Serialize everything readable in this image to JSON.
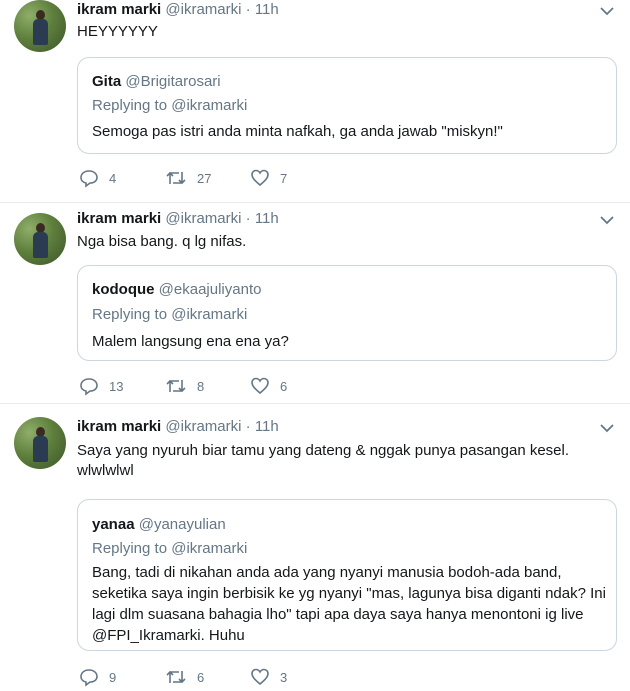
{
  "tweets": [
    {
      "name": "ikram marki",
      "handle": "@ikramarki",
      "dot": "·",
      "time": "11h",
      "text": "HEYYYYYY",
      "quote": {
        "name": "Gita",
        "handle": "@Brigitarosari",
        "replying": "Replying to @ikramarki",
        "text": "Semoga pas istri anda minta nafkah, ga anda jawab \"miskyn!\""
      },
      "replies": "4",
      "retweets": "27",
      "likes": "7"
    },
    {
      "name": "ikram marki",
      "handle": "@ikramarki",
      "dot": "·",
      "time": "11h",
      "text": "Nga bisa bang. q lg nifas.",
      "quote": {
        "name": "kodoque",
        "handle": "@ekaajuliyanto",
        "replying": "Replying to @ikramarki",
        "text": "Malem langsung ena ena ya?"
      },
      "replies": "13",
      "retweets": "8",
      "likes": "6"
    },
    {
      "name": "ikram marki",
      "handle": "@ikramarki",
      "dot": "·",
      "time": "11h",
      "text": "Saya yang nyuruh biar tamu yang dateng & nggak punya pasangan kesel. wlwlwlwl",
      "quote": {
        "name": "yanaa",
        "handle": "@yanayulian",
        "replying": "Replying to @ikramarki",
        "text": "Bang, tadi di nikahan anda ada yang nyanyi manusia bodoh-ada band, seketika saya ingin berbisik ke yg nyanyi \"mas, lagunya bisa diganti ndak? Ini lagi dlm suasana bahagia lho\" tapi apa daya saya hanya menontoni ig live @FPI_Ikramarki. Huhu"
      },
      "replies": "9",
      "retweets": "6",
      "likes": "3"
    }
  ],
  "icons": {
    "reply": "reply-icon",
    "retweet": "retweet-icon",
    "like": "heart-icon",
    "caret": "chevron-down-icon"
  },
  "colors": {
    "secondary_text": "#657786",
    "border": "#ccd6dd",
    "divider": "#e6ecf0"
  }
}
